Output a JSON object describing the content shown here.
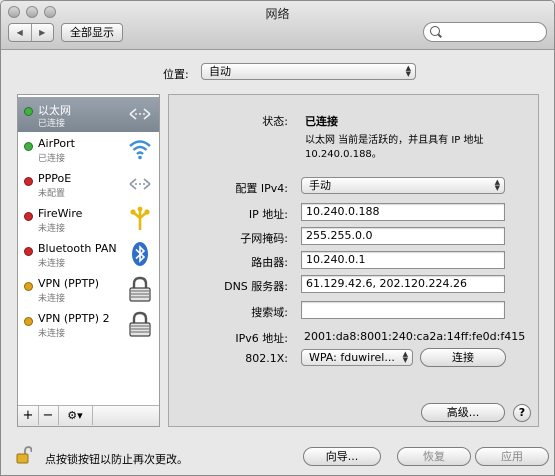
{
  "window": {
    "title": "网络"
  },
  "toolbar": {
    "back": "◀",
    "forward": "▶",
    "show_all": "全部显示",
    "search_placeholder": ""
  },
  "location": {
    "label": "位置:",
    "value": "自动"
  },
  "services": [
    {
      "name": "以太网",
      "status": "已连接",
      "dot_color": "#3fb33f",
      "icon": "ethernet-icon",
      "selected": true
    },
    {
      "name": "AirPort",
      "status": "已连接",
      "dot_color": "#3fb33f",
      "icon": "wifi-icon",
      "selected": false
    },
    {
      "name": "PPPoE",
      "status": "未配置",
      "dot_color": "#d0262a",
      "icon": "ethernet-icon",
      "selected": false
    },
    {
      "name": "FireWire",
      "status": "未连接",
      "dot_color": "#d0262a",
      "icon": "firewire-icon",
      "selected": false
    },
    {
      "name": "Bluetooth PAN",
      "status": "未连接",
      "dot_color": "#d0262a",
      "icon": "bluetooth-icon",
      "selected": false
    },
    {
      "name": "VPN (PPTP)",
      "status": "未连接",
      "dot_color": "#e0a21a",
      "icon": "vpn-lock-icon",
      "selected": false
    },
    {
      "name": "VPN (PPTP) 2",
      "status": "未连接",
      "dot_color": "#e0a21a",
      "icon": "vpn-lock-icon",
      "selected": false
    }
  ],
  "sidebar_controls": {
    "add": "+",
    "remove": "−",
    "action": "⚙▾"
  },
  "details": {
    "status_label": "状态:",
    "status_value": "已连接",
    "status_desc_1": "以太网 当前是活跃的，并且具有 IP 地址",
    "status_desc_2": "10.240.0.188。",
    "config_label": "配置 IPv4:",
    "config_value": "手动",
    "ip_label": "IP 地址:",
    "ip_value": "10.240.0.188",
    "mask_label": "子网掩码:",
    "mask_value": "255.255.0.0",
    "router_label": "路由器:",
    "router_value": "10.240.0.1",
    "dns_label": "DNS 服务器:",
    "dns_value": "61.129.42.6, 202.120.224.26",
    "search_domain_label": "搜索域:",
    "search_domain_value": "",
    "ipv6_label": "IPv6 地址:",
    "ipv6_value": "2001:da8:8001:240:ca2a:14ff:fe0d:f415",
    "dot1x_label": "802.1X:",
    "dot1x_value": "WPA: fduwirel...",
    "connect_button": "连接",
    "advanced_button": "高级...",
    "help_button": "?"
  },
  "bottom": {
    "lock_text": "点按锁按钮以防止再次更改。",
    "assist_button": "向导...",
    "revert_button": "恢复",
    "apply_button": "应用"
  },
  "colors": {
    "selected_row": "#8a949f",
    "green": "#3fb33f",
    "red": "#d0262a",
    "yellow": "#e0a21a"
  }
}
